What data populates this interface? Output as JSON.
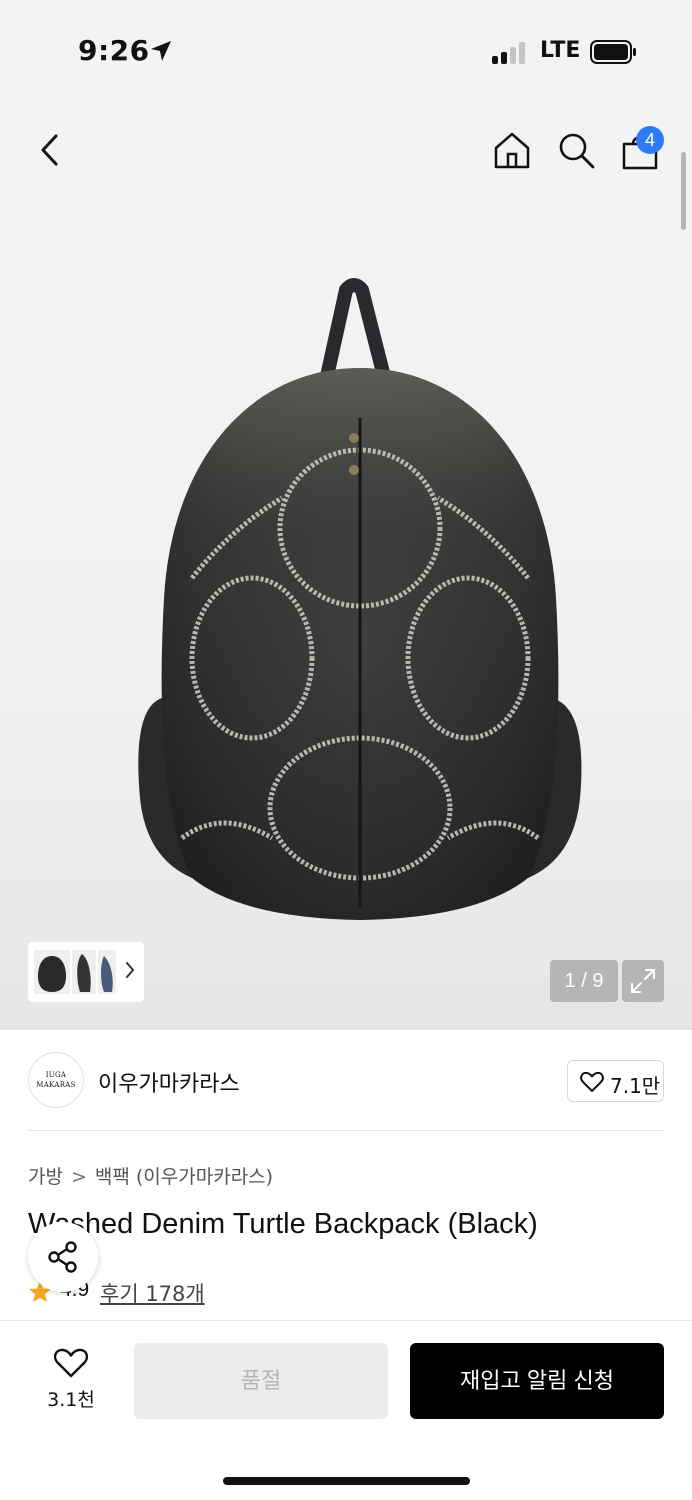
{
  "status": {
    "time": "9:26",
    "network": "LTE",
    "icons": [
      "location-arrow-icon",
      "signal-icon",
      "battery-icon"
    ]
  },
  "nav": {
    "icons": [
      "back-chevron-icon",
      "home-icon",
      "search-icon",
      "shopping-bag-icon"
    ],
    "cart_count": "4"
  },
  "gallery": {
    "counter": "1 / 9",
    "thumbnails": [
      "thumbnail-backpack-black",
      "thumbnail-backpack-side",
      "thumbnail-backpack-blue"
    ],
    "icons": [
      "chevron-right-icon",
      "expand-icon"
    ]
  },
  "brand": {
    "logo_text_line1": "IUGA",
    "logo_text_line2": "MAKARAS",
    "name": "이우가마카라스",
    "likes": "7.1만"
  },
  "product": {
    "breadcrumb": [
      "가방",
      "백팩 (이우가마카라스)"
    ],
    "title": "Washed Denim Turtle Backpack (Black)",
    "rating": "4.9",
    "reviews": "후기 178개"
  },
  "bottom": {
    "wish_count": "3.1천",
    "soldout_label": "품절",
    "restock_label": "재입고 알림 신청"
  },
  "colors": {
    "accent_blue": "#2f7bf6",
    "star": "#f5a623",
    "primary_button": "#000000",
    "disabled_button": "#ececec"
  }
}
